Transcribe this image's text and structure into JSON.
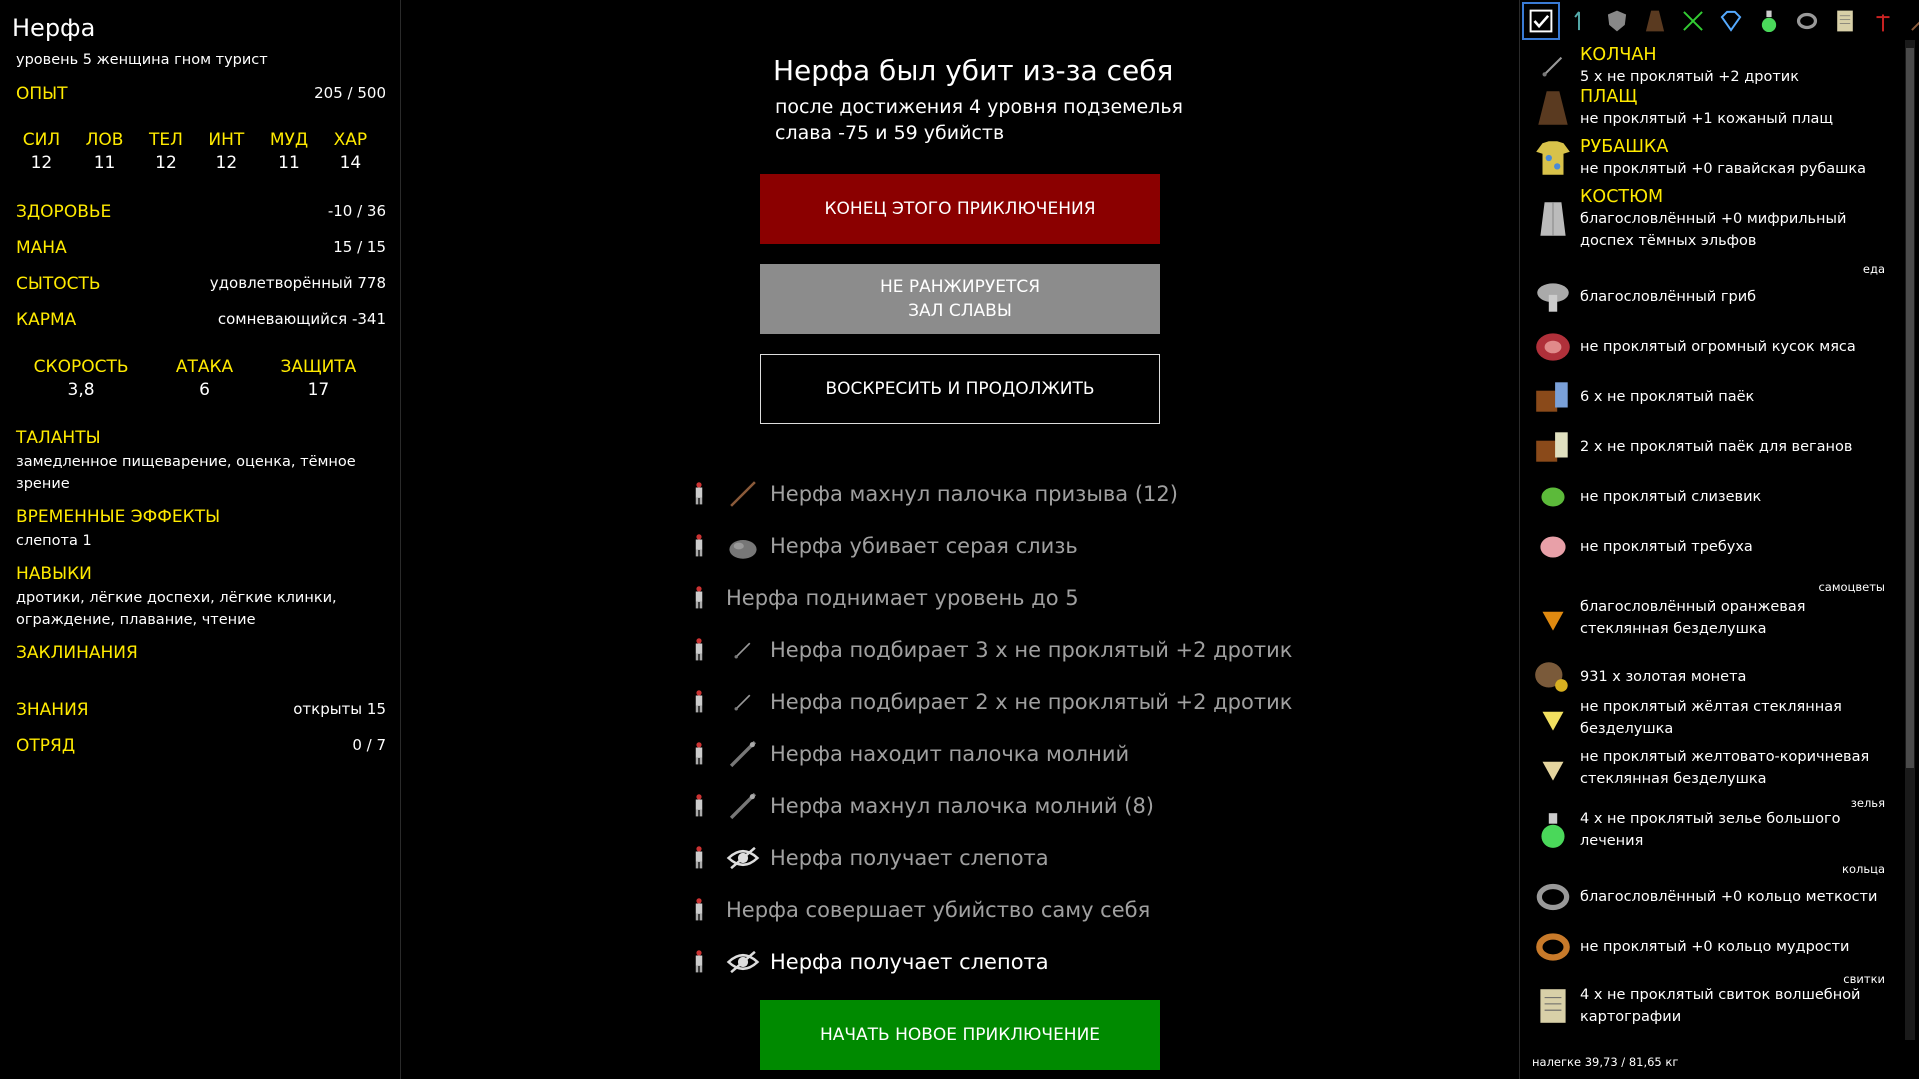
{
  "character": {
    "name": "Нерфа",
    "description": "уровень 5 женщина гном турист",
    "xp_label": "ОПЫТ",
    "xp_value": "205 / 500",
    "attributes": [
      {
        "label": "СИЛ",
        "value": "12"
      },
      {
        "label": "ЛОВ",
        "value": "11"
      },
      {
        "label": "ТЕЛ",
        "value": "12"
      },
      {
        "label": "ИНТ",
        "value": "12"
      },
      {
        "label": "МУД",
        "value": "11"
      },
      {
        "label": "ХАР",
        "value": "14"
      }
    ],
    "health_label": "ЗДОРОВЬЕ",
    "health_value": "-10 / 36",
    "mana_label": "МАНА",
    "mana_value": "15 / 15",
    "satiety_label": "СЫТОСТЬ",
    "satiety_value": "удовлетворённый 778",
    "karma_label": "КАРМА",
    "karma_value": "сомневающийся -341",
    "speed_label": "СКОРОСТЬ",
    "speed_value": "3,8",
    "attack_label": "АТАКА",
    "attack_value": "6",
    "defense_label": "ЗАЩИТА",
    "defense_value": "17",
    "talents_label": "ТАЛАНТЫ",
    "talents_value": "замедленное пищеварение, оценка, тёмное зрение",
    "effects_label": "ВРЕМЕННЫЕ ЭФФЕКТЫ",
    "effects_value": "слепота 1",
    "skills_label": "НАВЫКИ",
    "skills_value": "дротики, лёгкие доспехи, лёгкие клинки, ограждение, плавание, чтение",
    "spells_label": "ЗАКЛИНАНИЯ",
    "knowledge_label": "ЗНАНИЯ",
    "knowledge_value": "открыты 15",
    "party_label": "ОТРЯД",
    "party_value": "0 / 7"
  },
  "death": {
    "title": "Нерфа был убит из-за себя",
    "line1": "после достижения 4 уровня подземелья",
    "line2": "слава -75 и 59 убийств",
    "btn_end": "КОНЕЦ ЭТОГО ПРИКЛЮЧЕНИЯ",
    "btn_unranked_1": "НЕ РАНЖИРУЕТСЯ",
    "btn_unranked_2": "ЗАЛ СЛАВЫ",
    "btn_resurrect": "ВОСКРЕСИТЬ И ПРОДОЛЖИТЬ",
    "btn_new": "НАЧАТЬ НОВОЕ ПРИКЛЮЧЕНИЕ"
  },
  "log": [
    {
      "text": "Нерфа махнул палочка призыва (12)",
      "icon": "wand-icon"
    },
    {
      "text": "Нерфа убивает серая слизь",
      "icon": "gray-ooze-icon"
    },
    {
      "text": "Нерфа поднимает уровень до 5",
      "icon": ""
    },
    {
      "text": "Нерфа подбирает 3 х не проклятый +2 дротик",
      "icon": "dart-icon"
    },
    {
      "text": "Нерфа подбирает 2 х не проклятый +2 дротик",
      "icon": "dart-icon"
    },
    {
      "text": "Нерфа находит палочка молний",
      "icon": "lightning-wand-icon"
    },
    {
      "text": "Нерфа махнул палочка молний (8)",
      "icon": "lightning-wand-icon"
    },
    {
      "text": "Нерфа получает слепота",
      "icon": "blind-eye-icon"
    },
    {
      "text": "Нерфа совершает убийство саму себя",
      "icon": ""
    },
    {
      "text": "Нерфа получает слепота",
      "icon": "blind-eye-icon"
    }
  ],
  "inventory": {
    "tabs": [
      "check-icon",
      "arrows-icon",
      "shield-icon",
      "cloak-icon",
      "swords-icon",
      "gem-icon",
      "potion-icon",
      "ring-icon",
      "scroll-icon",
      "ankh-icon",
      "wand-icon",
      "sword-icon"
    ],
    "items": [
      {
        "head": "КОЛЧАН",
        "text": "5 х не проклятый +2 дротик",
        "icon": "dart-icon"
      },
      {
        "head": "ПЛАЩ",
        "text": "не проклятый +1 кожаный плащ",
        "icon": "cloak-icon"
      },
      {
        "head": "РУБАШКА",
        "text": "не проклятый +0 гавайская рубашка",
        "icon": "shirt-icon"
      },
      {
        "head": "КОСТЮМ",
        "text": "благословлённый +0 мифрильный доспех тёмных эльфов",
        "icon": "mithril-icon"
      },
      {
        "head": "",
        "text": "благословлённый гриб",
        "icon": "mushroom-icon"
      },
      {
        "head": "",
        "text": "не проклятый огромный кусок мяса",
        "icon": "meat-icon"
      },
      {
        "head": "",
        "text": "6 х не проклятый паёк",
        "icon": "ration-icon"
      },
      {
        "head": "",
        "text": "2 х не проклятый паёк для веганов",
        "icon": "vegan-ration-icon"
      },
      {
        "head": "",
        "text": "не проклятый слизевик",
        "icon": "slime-mold-icon"
      },
      {
        "head": "",
        "text": "не проклятый требуха",
        "icon": "tripe-icon"
      },
      {
        "head": "",
        "text": "благословлённый оранжевая стеклянная безделушка",
        "icon": "orange-gem-icon"
      },
      {
        "head": "",
        "text": "931 х золотая монета",
        "icon": "gold-icon"
      },
      {
        "head": "",
        "text": "не проклятый жёлтая стеклянная безделушка",
        "icon": "yellow-gem-icon"
      },
      {
        "head": "",
        "text": "не проклятый желтовато-коричневая стеклянная безделушка",
        "icon": "brown-gem-icon"
      },
      {
        "head": "",
        "text": "4 х не проклятый зелье большого лечения",
        "icon": "potion-icon"
      },
      {
        "head": "",
        "text": "благословлённый +0 кольцо меткости",
        "icon": "ring-icon"
      },
      {
        "head": "",
        "text": "не проклятый +0 кольцо мудрости",
        "icon": "gold-ring-icon"
      },
      {
        "head": "",
        "text": "4 х не проклятый свиток волшебной картографии",
        "icon": "scroll-icon"
      }
    ],
    "categories": {
      "food": "еда",
      "gems": "самоцветы",
      "potions": "зелья",
      "rings": "кольца",
      "scrolls": "свитки"
    },
    "weight": "налегке 39,73 / 81,65 кг"
  }
}
